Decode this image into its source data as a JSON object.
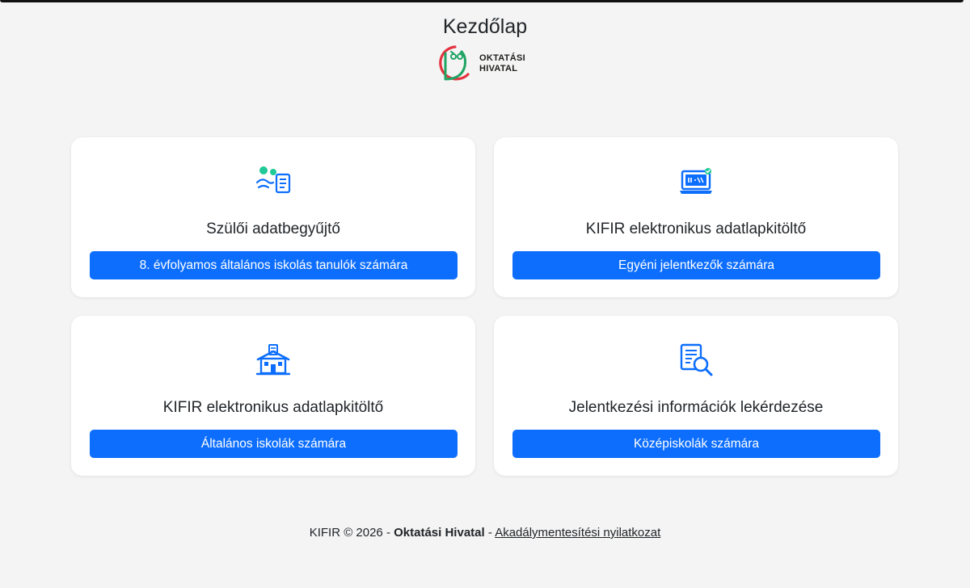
{
  "header": {
    "title": "Kezdőlap",
    "logo": {
      "line1": "OKTATÁSI",
      "line2": "HIVATAL",
      "colors": {
        "red": "#e4333e",
        "green": "#1fa463"
      }
    }
  },
  "cards": [
    {
      "icon": "parents-document-icon",
      "title": "Szülői adatbegyűjtő",
      "button": "8. évfolyamos általános iskolás tanulók számára"
    },
    {
      "icon": "laptop-form-icon",
      "title": "KIFIR elektronikus adatlapkitöltő",
      "button": "Egyéni jelentkezők számára"
    },
    {
      "icon": "school-building-icon",
      "title": "KIFIR elektronikus adatlapkitöltő",
      "button": "Általános iskolák számára"
    },
    {
      "icon": "document-search-icon",
      "title": "Jelentkezési információk lekérdezése",
      "button": "Középiskolák számára"
    }
  ],
  "footer": {
    "prefix": "KIFIR © 2026 - ",
    "org": "Oktatási Hivatal",
    "separator": " - ",
    "link": "Akadálymentesítési nyilatkozat"
  },
  "colors": {
    "primary": "#0d6efd",
    "accent_green": "#20c997",
    "background": "#f4f4f4"
  }
}
